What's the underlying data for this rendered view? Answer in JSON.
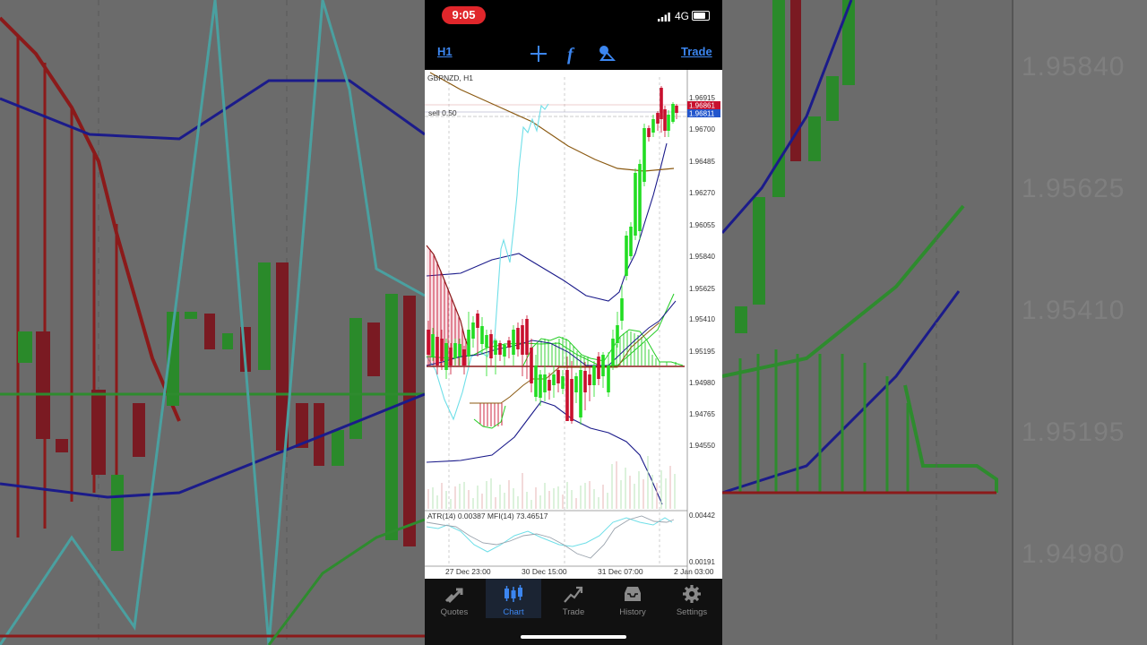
{
  "status_bar": {
    "time": "9:05",
    "network": "4G"
  },
  "toolbar": {
    "timeframe": "H1",
    "trade": "Trade"
  },
  "chart": {
    "symbol_label": "GBPNZD, H1",
    "order_label": "sell 0.50",
    "price_axis": [
      "1.96915",
      "1.96700",
      "1.96485",
      "1.96270",
      "1.96055",
      "1.95840",
      "1.95625",
      "1.95410",
      "1.95195",
      "1.94980",
      "1.94765",
      "1.94550"
    ],
    "ask_price": "1.96861",
    "bid_price": "1.96811",
    "indicator_label": "ATR(14) 0.00387 MFI(14) 73.46517",
    "indicator_axis": [
      "0.00442",
      "0.00191"
    ],
    "time_axis": [
      "27 Dec 23:00",
      "30 Dec 15:00",
      "31 Dec 07:00",
      "2 Jan 03:00"
    ],
    "colors": {
      "bull": "#22dd22",
      "bear": "#c8102e",
      "ask": "#c8102e",
      "bid": "#2255cc",
      "accent": "#3c86f0"
    }
  },
  "tabs": [
    {
      "label": "Quotes",
      "icon": "quotes-icon"
    },
    {
      "label": "Chart",
      "icon": "chart-icon",
      "active": true
    },
    {
      "label": "Trade",
      "icon": "trade-icon"
    },
    {
      "label": "History",
      "icon": "history-icon"
    },
    {
      "label": "Settings",
      "icon": "settings-icon"
    }
  ],
  "background": {
    "prices": [
      "1.95840",
      "1.95625",
      "1.95410",
      "1.95195",
      "1.94980"
    ]
  }
}
